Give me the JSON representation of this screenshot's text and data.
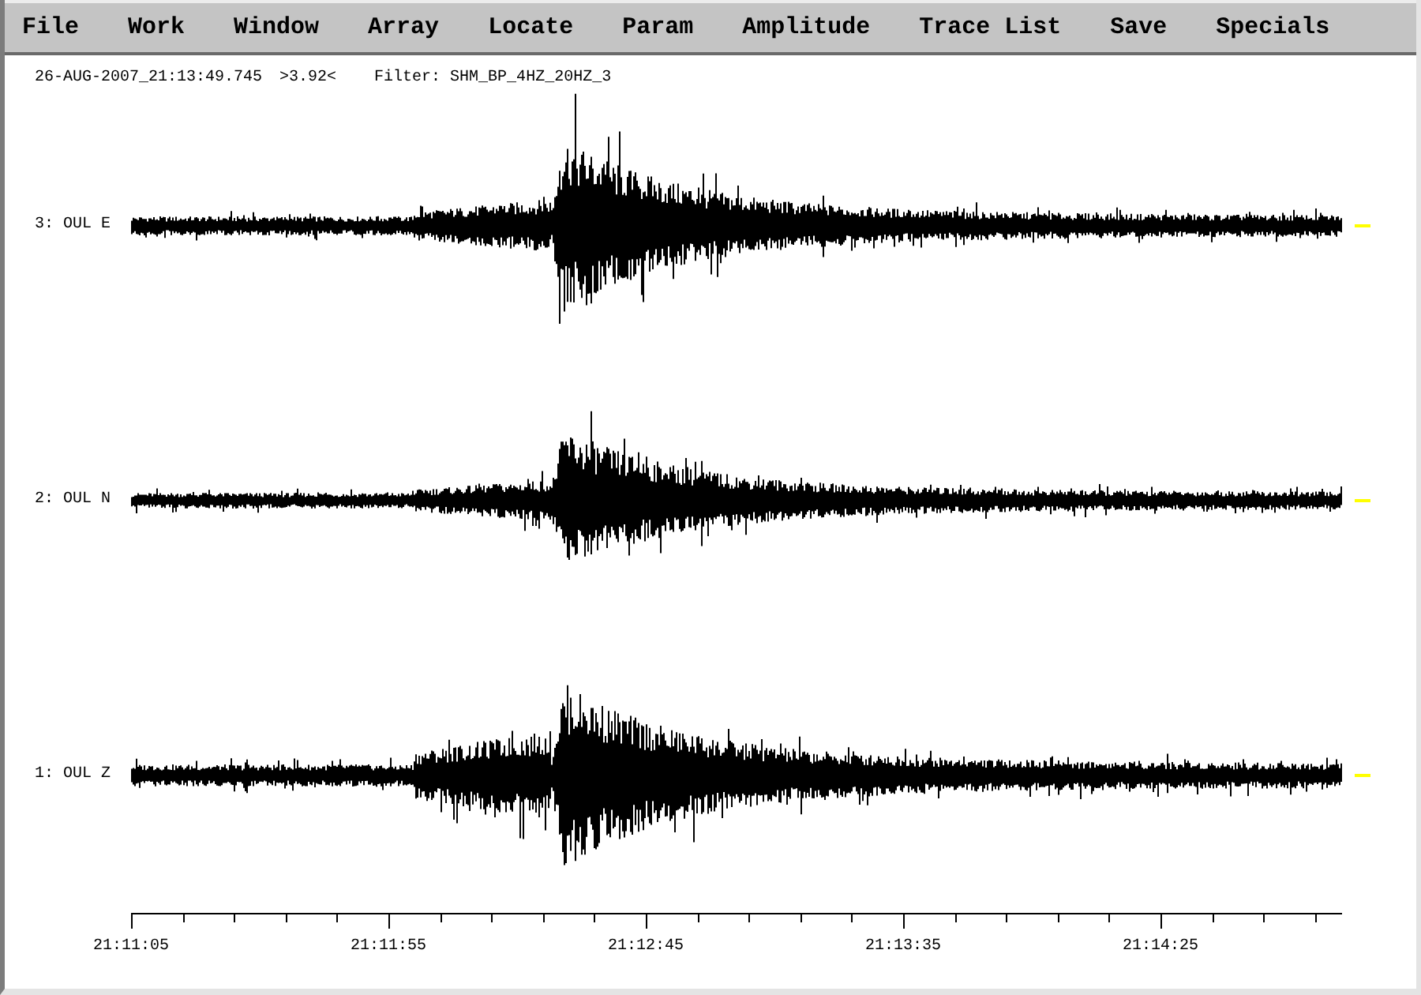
{
  "menu_bar": [
    "File",
    "Work",
    "Window",
    "Array",
    "Locate",
    "Param",
    "Amplitude",
    "Trace List",
    "Save",
    "Specials"
  ],
  "header": {
    "timestamp": "26-AUG-2007_21:13:49.745",
    "value": ">3.92<",
    "filter": "Filter: SHM_BP_4HZ_20HZ_3"
  },
  "traces": [
    {
      "label": "3: OUL E"
    },
    {
      "label": "2: OUL N"
    },
    {
      "label": "1: OUL Z"
    }
  ],
  "time_axis": {
    "labels": [
      "21:11:05",
      "21:11:55",
      "21:12:45",
      "21:13:35",
      "21:14:25"
    ]
  }
}
